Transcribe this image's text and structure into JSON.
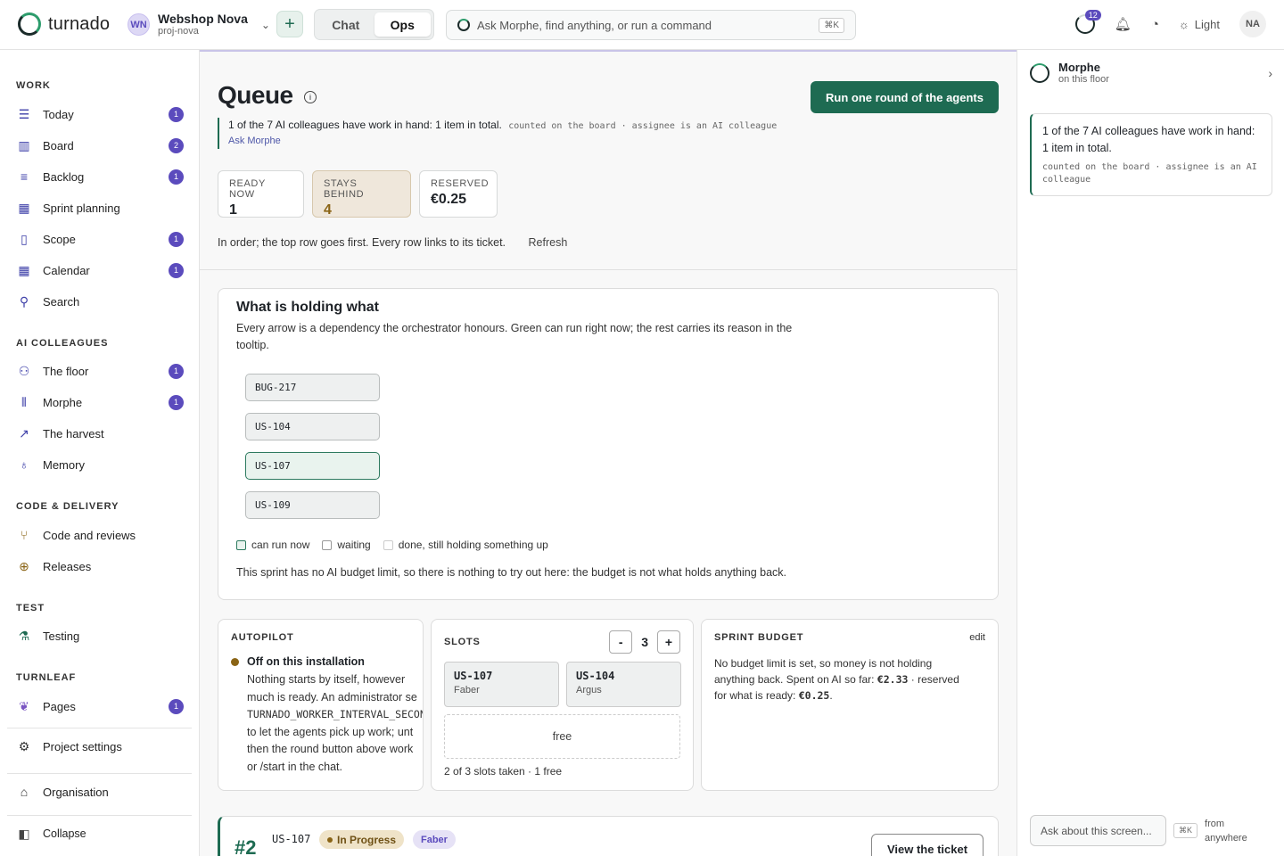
{
  "app": {
    "name": "turnado"
  },
  "workspace": {
    "initials": "WN",
    "name": "Webshop Nova",
    "slug": "proj-nova"
  },
  "mode_tabs": [
    "Chat",
    "Ops"
  ],
  "search": {
    "placeholder": "Ask Morphe, find anything, or run a command",
    "shortcut": "⌘K"
  },
  "header_right": {
    "notifications": "12",
    "theme": "Light",
    "avatar": "NA"
  },
  "sidebar": {
    "sections": {
      "work": "WORK",
      "ai": "AI COLLEAGUES",
      "code": "CODE & DELIVERY",
      "test": "TEST",
      "turnleaf": "TURNLEAF"
    },
    "work": [
      {
        "label": "Today",
        "count": "1"
      },
      {
        "label": "Board",
        "count": "2"
      },
      {
        "label": "Backlog",
        "count": "1"
      },
      {
        "label": "Sprint planning",
        "count": ""
      },
      {
        "label": "Scope",
        "count": "1"
      },
      {
        "label": "Calendar",
        "count": "1"
      },
      {
        "label": "Search",
        "count": ""
      }
    ],
    "ai": [
      {
        "label": "The floor",
        "count": "1"
      },
      {
        "label": "Morphe",
        "count": "1"
      },
      {
        "label": "The harvest",
        "count": ""
      },
      {
        "label": "Memory",
        "count": ""
      }
    ],
    "code": [
      {
        "label": "Code and reviews"
      },
      {
        "label": "Releases"
      }
    ],
    "test": [
      {
        "label": "Testing"
      }
    ],
    "turnleaf": [
      {
        "label": "Pages",
        "count": "1"
      }
    ],
    "project_settings": "Project settings",
    "organisation": "Organisation",
    "collapse": "Collapse"
  },
  "queue": {
    "title": "Queue",
    "run_button": "Run one round of the agents",
    "summary": "1 of the 7 AI colleagues have work in hand: 1 item in total.",
    "summary_note": "counted on the board · assignee is an AI colleague",
    "ask": "Ask Morphe",
    "stats": [
      {
        "label": "READY NOW",
        "value": "1"
      },
      {
        "label": "STAYS BEHIND",
        "value": "4"
      },
      {
        "label": "RESERVED",
        "value": "€0.25"
      }
    ],
    "order_text": "In order; the top row goes first. Every row links to its ticket.",
    "refresh": "Refresh"
  },
  "holding": {
    "title": "What is holding what",
    "desc": "Every arrow is a dependency the orchestrator honours. Green can run right now; the rest carries its reason in the tooltip.",
    "tickets": [
      "BUG-217",
      "US-104",
      "US-107",
      "US-109"
    ],
    "legend": [
      "can run now",
      "waiting",
      "done, still holding something up"
    ],
    "note": "This sprint has no AI budget limit, so there is nothing to try out here: the budget is not what holds anything back."
  },
  "autopilot": {
    "title": "AUTOPILOT",
    "status": "Off on this installation",
    "lines": [
      "Nothing starts by itself, however",
      "much is ready. An administrator se",
      "TURNADO_WORKER_INTERVAL_SECON",
      "to let the agents pick up work; unt",
      "then the round button above work",
      "or /start in the chat."
    ]
  },
  "slots": {
    "title": "SLOTS",
    "count": "3",
    "minus": "-",
    "plus": "+",
    "items": [
      {
        "id": "US-107",
        "agent": "Faber"
      },
      {
        "id": "US-104",
        "agent": "Argus"
      }
    ],
    "free": "free",
    "summary": "2 of 3 slots taken · 1 free"
  },
  "budget": {
    "title": "SPRINT BUDGET",
    "edit": "edit",
    "text_a": "No budget limit is set, so money is not holding anything back. Spent on AI so far:",
    "spent": "€2.33",
    "text_b": "· reserved for what is ready:",
    "reserved": "€0.25",
    "text_c": "."
  },
  "row": {
    "rank": "#2",
    "id": "US-107",
    "status": "In Progress",
    "agent": "Faber",
    "button": "View the ticket"
  },
  "right_panel": {
    "name": "Morphe",
    "sub": "on this floor",
    "card_text": "1 of the 7 AI colleagues have work in hand: 1 item in total.",
    "card_note": "counted on the board · assignee is an AI colleague",
    "input_placeholder": "Ask about this screen...",
    "shortcut": "⌘K",
    "from": "from anywhere"
  },
  "colors": {
    "accent": "#1e6b52",
    "badge": "#5b4bbd",
    "warn": "#8a6415"
  }
}
